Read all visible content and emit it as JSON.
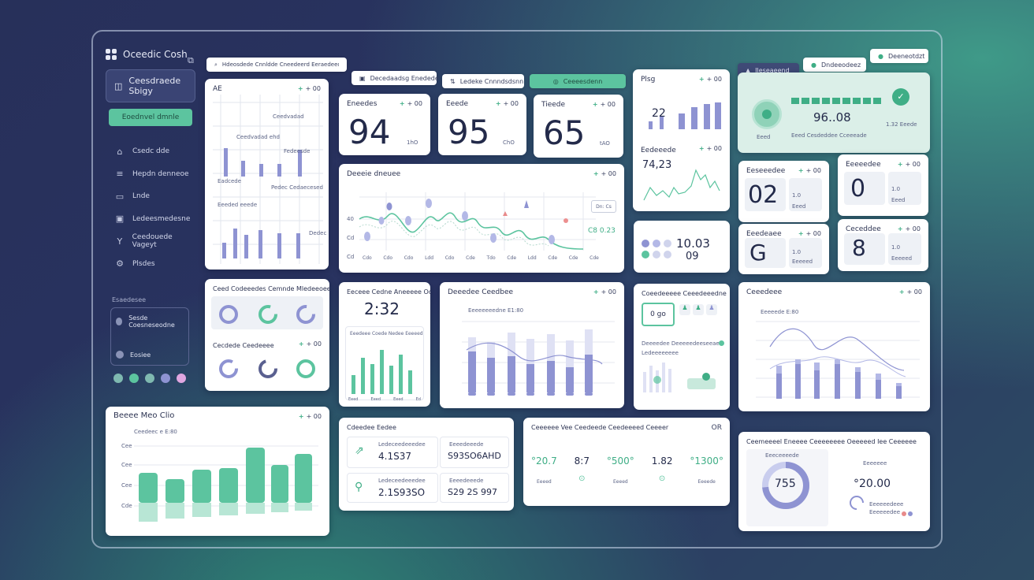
{
  "app": {
    "title": "Oceedic Cosh",
    "current": "Ceesdraede Sbigy",
    "cta": "Eoednvel dmnle"
  },
  "nav": [
    {
      "icon": "⌂",
      "label": "Csedc dde"
    },
    {
      "icon": "≡",
      "label": "Hepdn denneoe"
    },
    {
      "icon": "▭",
      "label": "Lnde"
    },
    {
      "icon": "▣",
      "label": "Ledeesmedesne"
    },
    {
      "icon": "Y",
      "label": "Ceedouede Vageyt"
    },
    {
      "icon": "⚙",
      "label": "Plsdes"
    }
  ],
  "sidebar": {
    "section": "Esaedesee",
    "rows": [
      "Sesde Coesneseodne",
      "Eosiee"
    ]
  },
  "toolbar": {
    "search": "Hdeosdede Cnnldde Cneedeerd Eeraedeedls Cndy",
    "btn1": "Decedaadsg Enedede",
    "btn2": "Ledeke Cnnndsdsnn",
    "btn3": "Ceeeesdenn",
    "btn4": "Ileseaeend",
    "btn5": "Dndeeodeez",
    "btn6": "Deeneotdzt"
  },
  "cards": {
    "a": {
      "title": "AE",
      "badge": "+ 00",
      "l1": "Ceedvadad",
      "l2": "Ceedvadad ehd",
      "l3": "Fedeesde",
      "l4": "Eadcede",
      "l5": "Pedec Cedaecesed",
      "l6": "Eeeded eeede",
      "l7": "Dedec"
    },
    "k1": {
      "title": "Eneedes",
      "badge": "+ 00",
      "value": "94",
      "unit": "1hO"
    },
    "k2": {
      "title": "Eeede",
      "badge": "+ 00",
      "value": "95",
      "unit": "ChO"
    },
    "k3": {
      "title": "Tieede",
      "badge": "+ 00",
      "value": "65",
      "unit": "tAO"
    },
    "line": {
      "title": "Deeeie dneuee",
      "badge": "+ 00",
      "btns": "Dn: Cs",
      "val": "C8 0.23",
      "y1": "40",
      "y2": "Cd",
      "y3": "Cd",
      "x": [
        "Cdo",
        "Cdo",
        "Cdo",
        "Ldd",
        "Cdo",
        "Cde",
        "Tdo",
        "Cde",
        "Ldd",
        "Cde",
        "Cde",
        "Cde"
      ]
    },
    "m1": {
      "title": "Plsg",
      "badge": "+ 00",
      "value": "22"
    },
    "m2": {
      "title": "Eedeeede",
      "badge": "+ 00",
      "value": "74,23"
    },
    "m3": {
      "v1": "10.03",
      "v2": "09"
    },
    "rt": {
      "b1": "Ledenedd",
      "b2": "Deeaedeedeeed",
      "b3": "Deededeee",
      "value": "96..08",
      "sub1": "Eeed Cesdeddee Cceeeade",
      "sub2": "Eeed",
      "sub3": "1.32 Eeede"
    },
    "d1": {
      "title": "Eeseeedee",
      "badge": "+ 00",
      "value": "02",
      "u": "1.0",
      "u2": "Eeed"
    },
    "d2": {
      "title": "Eeeeedee",
      "badge": "+ 00",
      "value": "0",
      "u": "1.0",
      "u2": "Eeed"
    },
    "d3": {
      "title": "Eeedeaee",
      "badge": "+ 00",
      "value": "G",
      "u": "1.0",
      "u2": "Eeeeed"
    },
    "d4": {
      "title": "Ceceddee",
      "badge": "+ 00",
      "value": "8",
      "u": "1.0",
      "u2": "Eeeeed"
    },
    "rings": {
      "t1": "Ceed Codeeedes Cemnde Mledeeoeed",
      "t2": "Cecdede Ceedeeee",
      "badge": "+ 00"
    },
    "time": {
      "title": "Eeceee Cedne Aneeeee Oc",
      "value": "2:32",
      "sub": "Eeedeee Coede Nedee Eeeeed",
      "x": [
        "Eeed",
        "Eeed",
        "Eeed",
        "Ed"
      ]
    },
    "comb": {
      "title": "Deeedee Ceedbee",
      "badge": "+ 00",
      "sub": "Eeeeeeeedne  E1:80"
    },
    "team": {
      "title": "Coeedeeeee Ceeedeeedne",
      "badge": "+ 00",
      "sub": "Deeeedee Deeeeedeeseeaee",
      "v": "0 go",
      "f": "Ledeeeeeeee"
    },
    "ce": {
      "title": "Ceeedeee",
      "badge": "+ 00",
      "sub": "Eeeeede  E:80"
    },
    "area": {
      "title": "Beeee Meo Clio",
      "badge": "+ 00",
      "sub": "Ceedeec   e  E:80",
      "y": [
        "Cee",
        "Cee",
        "Cee",
        "Cde"
      ]
    },
    "stats": {
      "title": "Cdeedee Eedee",
      "s1": "Ledeceedeeedee",
      "s2": "Eeeedeeede",
      "v1": "4.1S37",
      "v2": "S93SO6AHD",
      "v3": "2.1S93SO",
      "v4": "S29 2S 997"
    },
    "dbl": {
      "title": "Ceeeeee Vee Ceedeede Ceedeeeed Ceeeer",
      "badge": "OR",
      "items": [
        {
          "v": "°20.7",
          "l": "Eeeed"
        },
        {
          "v": "8:7",
          "l": "Ceed"
        },
        {
          "v": "°500°",
          "l": "Eeeed"
        },
        {
          "v": "1.82",
          "l": "Ceed"
        },
        {
          "v": "°1300°",
          "l": "Eeeede"
        }
      ]
    },
    "donut": {
      "title": "Ceemeeeel Eneeee Ceeeeeeee Oeeeeed Iee Ceeeeee",
      "sub": "Eeeceeeede",
      "value": "755",
      "t2": "Eeeeeee",
      "v2": "°20.00",
      "sub3": "Eeeeeedeee",
      "sub4": "Eeeeeedee"
    }
  },
  "colors": {
    "green": "#5cc49f",
    "purple": "#8e93d2",
    "navy": "#2a3463"
  }
}
